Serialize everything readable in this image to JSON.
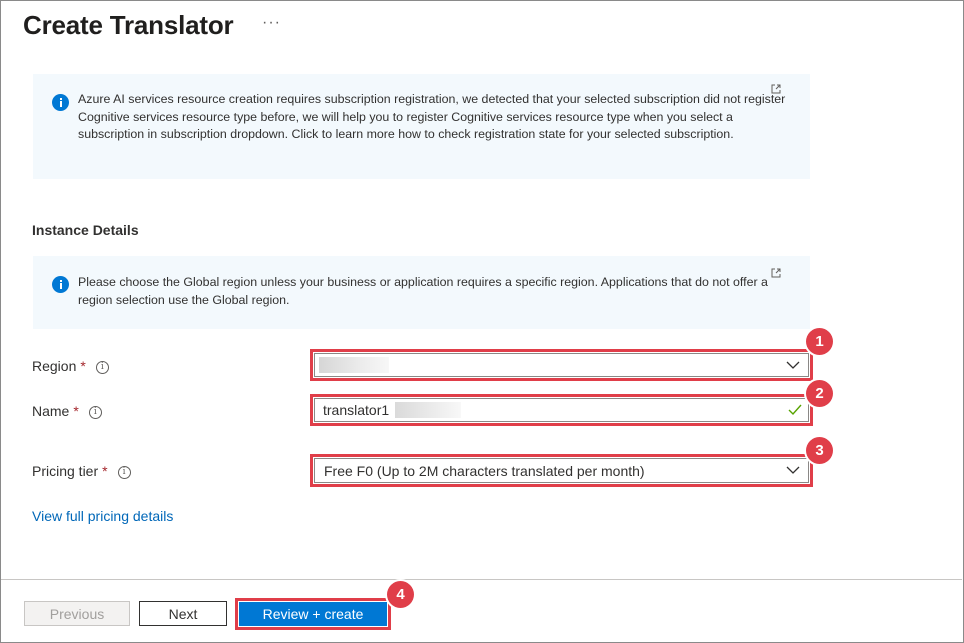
{
  "page": {
    "title": "Create Translator",
    "more_label": "···"
  },
  "info_banner_subscription": {
    "text": "Azure AI services resource creation requires subscription registration, we detected that your selected subscription did not register Cognitive services resource type before, we will help you to register Cognitive services resource type when you select a subscription in subscription dropdown. Click to learn more how to check registration state for your selected subscription."
  },
  "instance_details": {
    "heading": "Instance Details",
    "region_banner": "Please choose the Global region unless your business or application requires a specific region. Applications that do not offer a region selection use the Global region."
  },
  "fields": {
    "region": {
      "label": "Region",
      "required": "*",
      "value": ""
    },
    "name": {
      "label": "Name",
      "required": "*",
      "value": "translator1"
    },
    "pricing_tier": {
      "label": "Pricing tier",
      "required": "*",
      "value": "Free F0 (Up to 2M characters translated per month)"
    }
  },
  "pricing_link": "View full pricing details",
  "footer": {
    "previous_label": "Previous",
    "next_label": "Next",
    "review_label": "Review + create"
  },
  "step_badges": [
    "1",
    "2",
    "3",
    "4"
  ],
  "colors": {
    "accent": "#0078d4",
    "highlight": "#e03e49",
    "success": "#57a300",
    "required": "#a4262c"
  },
  "icons": [
    "info-icon",
    "external-link-icon",
    "tooltip-info-icon",
    "chevron-down-icon",
    "checkmark-icon",
    "more-icon"
  ]
}
